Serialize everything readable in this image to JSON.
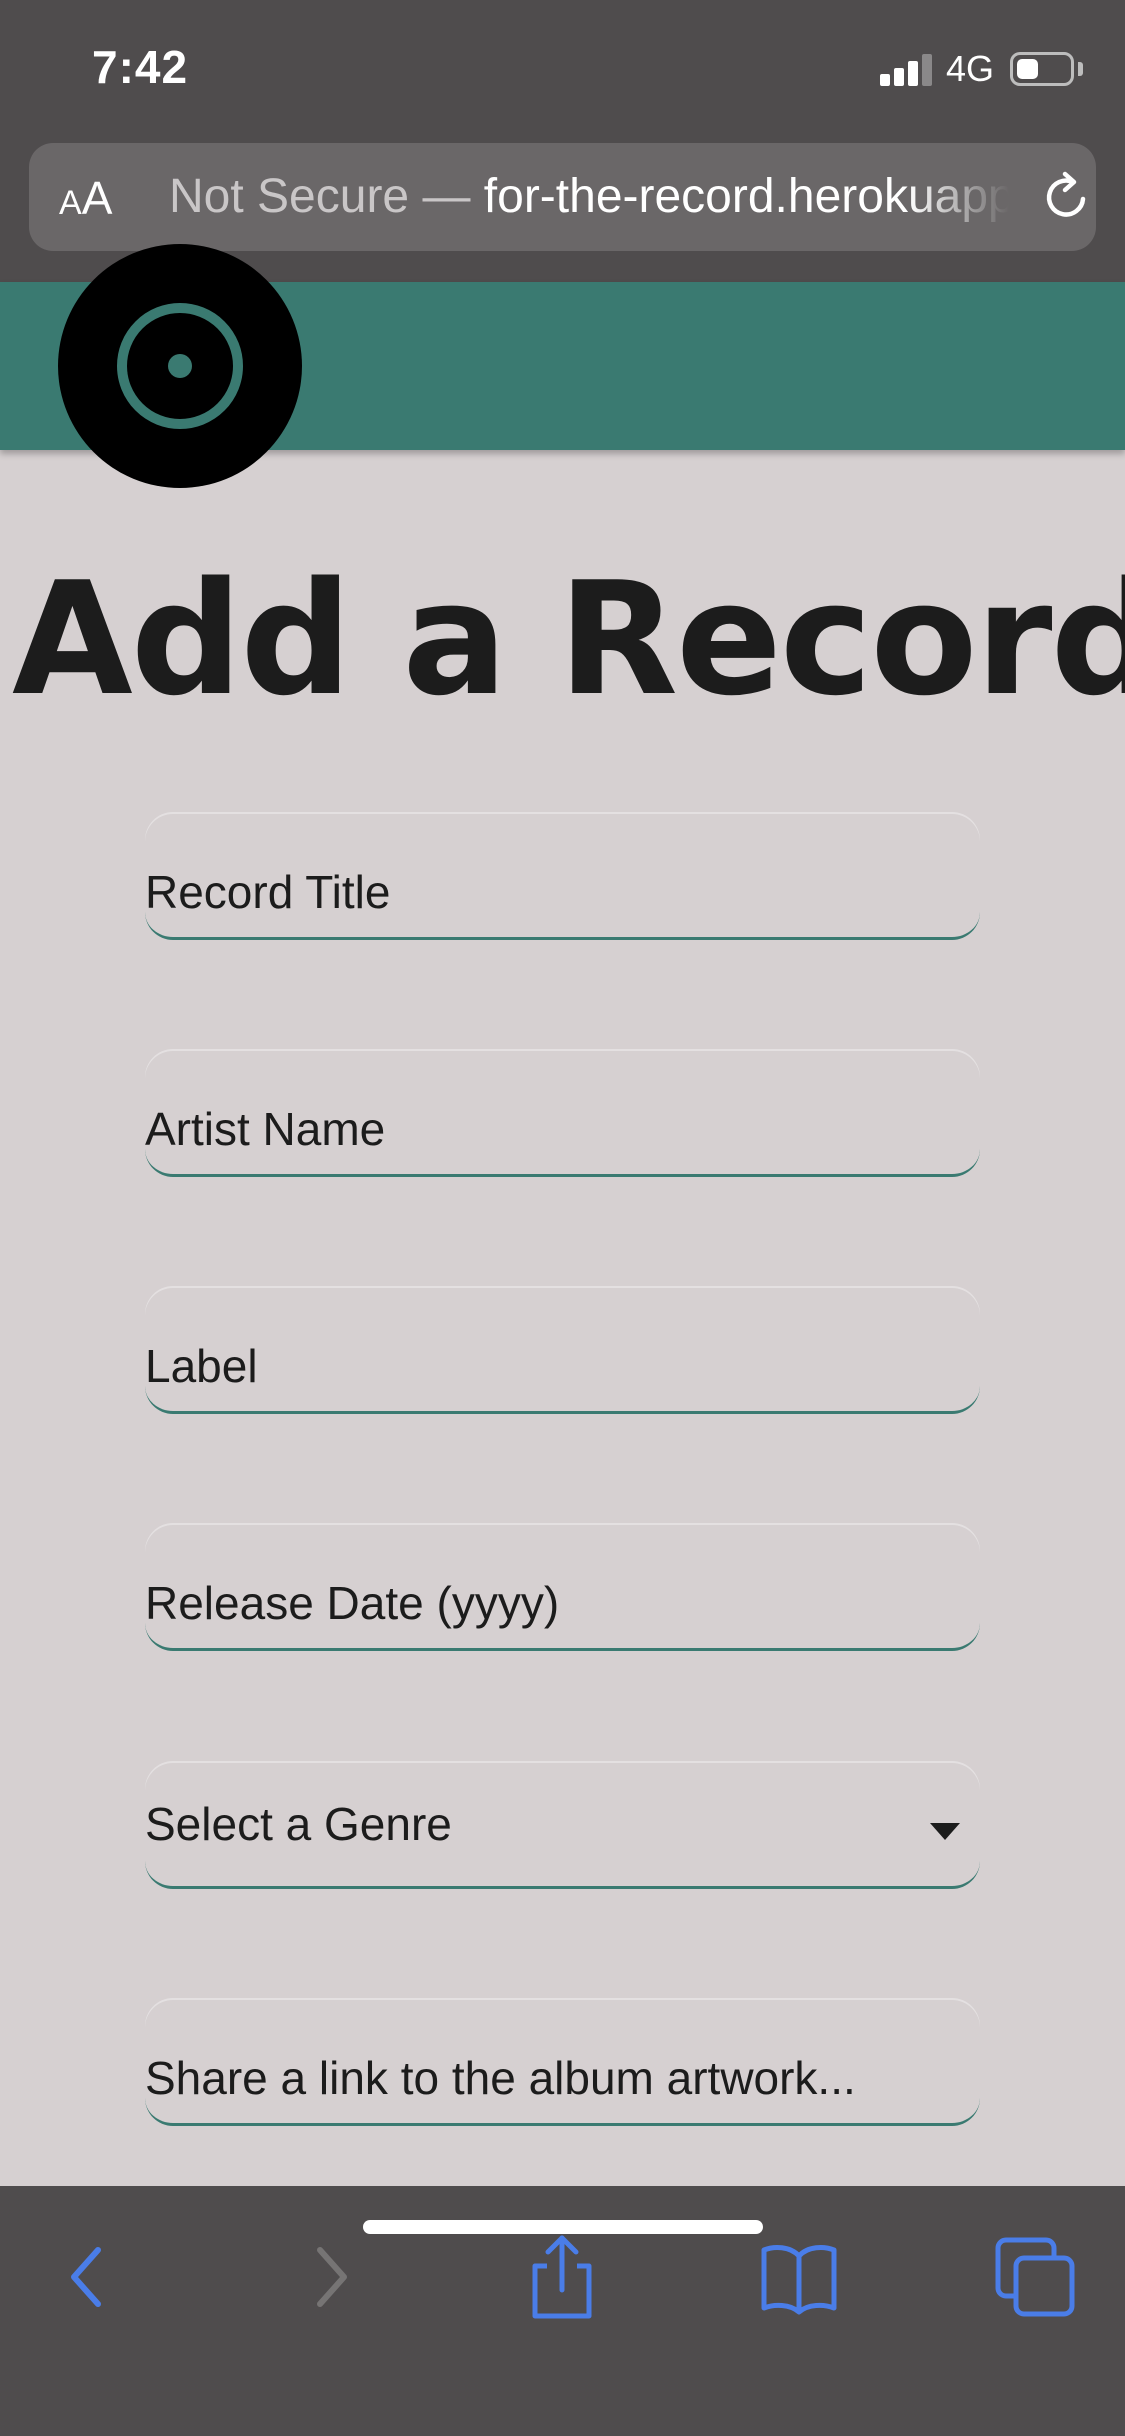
{
  "status_bar": {
    "time": "7:42",
    "network": "4G",
    "battery_level": 0.4
  },
  "browser": {
    "text_size_small": "A",
    "text_size_large": "A",
    "url_secure_label": "Not Secure —",
    "url_host": " for-the-record.herokuapp.com"
  },
  "page": {
    "title": "Add a Record..."
  },
  "form": {
    "record_title_placeholder": "Record Title",
    "artist_name_placeholder": "Artist Name",
    "label_placeholder": "Label",
    "release_date_placeholder": "Release Date (yyyy)",
    "genre_selected": "Select a Genre",
    "artwork_placeholder": "Share a link to the album artwork..."
  },
  "colors": {
    "accent": "#3a7a71",
    "page_background": "#d6d0d1",
    "chrome_background": "#4f4c4d",
    "toolbar_active": "#4a7de8",
    "toolbar_disabled": "#767474"
  },
  "icons": {
    "reload": "reload-icon",
    "back": "back-chevron-icon",
    "forward": "forward-chevron-icon",
    "share": "share-icon",
    "bookmarks": "book-icon",
    "tabs": "tabs-icon"
  }
}
